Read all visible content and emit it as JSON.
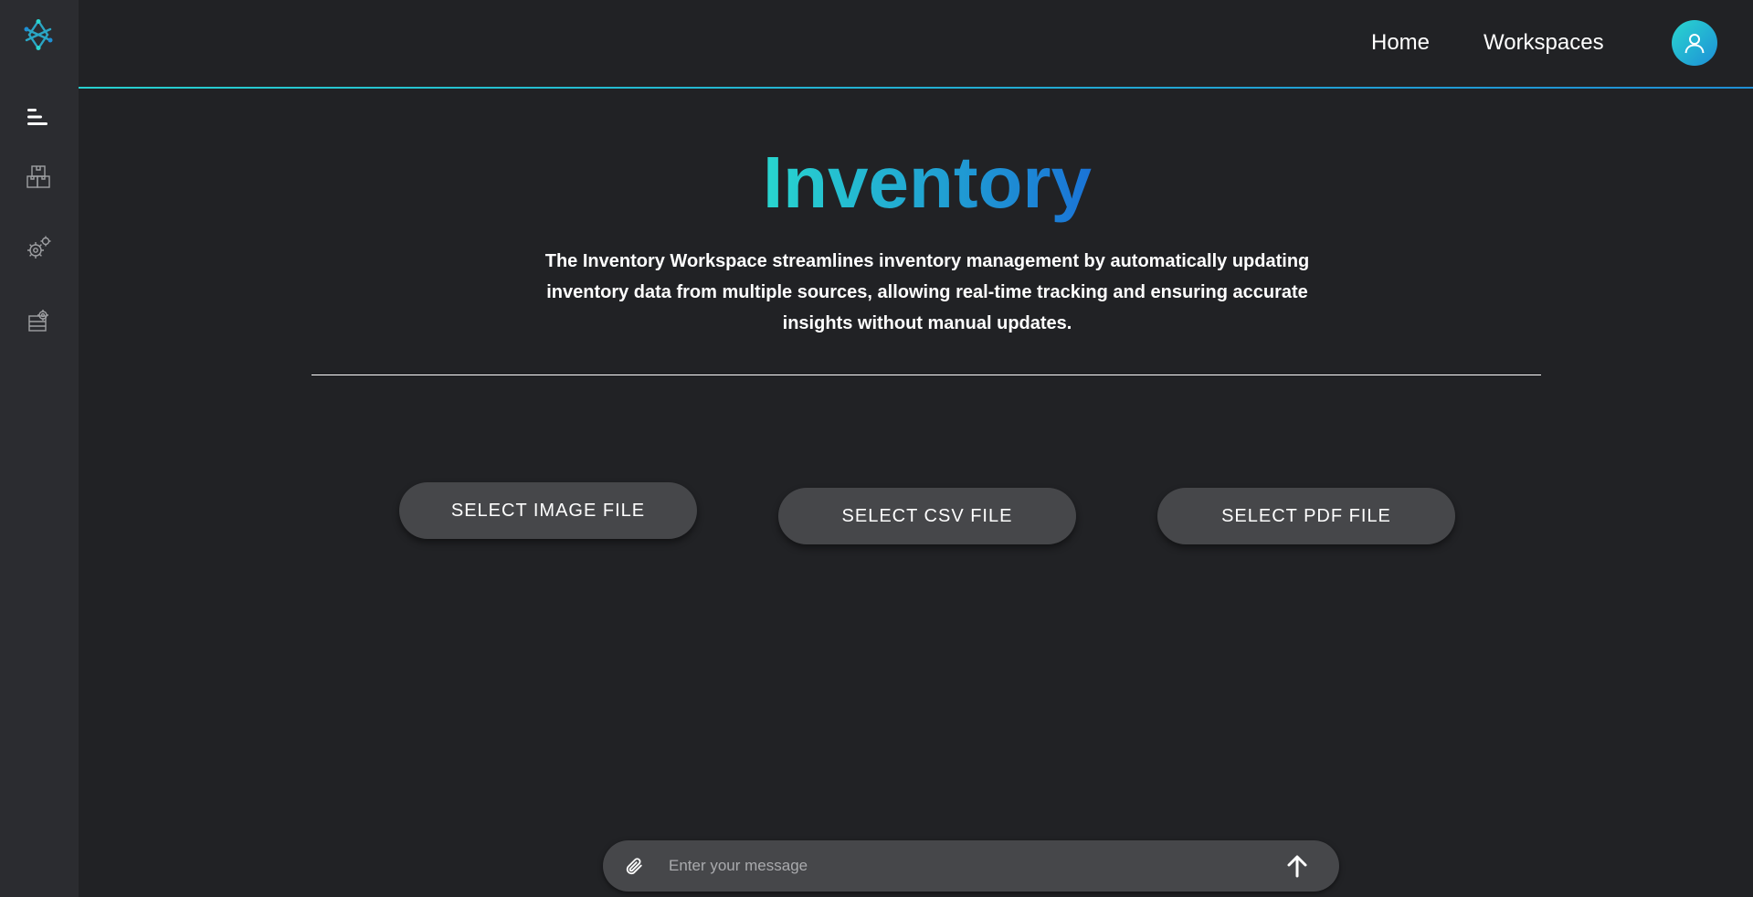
{
  "nav": {
    "home": "Home",
    "workspaces": "Workspaces"
  },
  "sidebar": {
    "items": [
      {
        "icon": "logo-icon"
      },
      {
        "icon": "menu-icon"
      },
      {
        "icon": "inventory-boxes-icon"
      },
      {
        "icon": "gears-icon"
      },
      {
        "icon": "settings-boxes-icon"
      }
    ]
  },
  "main": {
    "title": "Inventory",
    "description": "The Inventory Workspace streamlines inventory management by automatically updating inventory data from multiple sources, allowing real-time tracking and ensuring accurate insights without manual updates.",
    "buttons": {
      "image": "SELECT IMAGE FILE",
      "csv": "SELECT CSV FILE",
      "pdf": "SELECT PDF FILE"
    }
  },
  "chat": {
    "placeholder": "Enter your message"
  },
  "colors": {
    "background": "#212225",
    "sidebar": "#2b2c30",
    "accent_start": "#28d6cf",
    "accent_end": "#1a73d6",
    "button": "#46474a"
  }
}
